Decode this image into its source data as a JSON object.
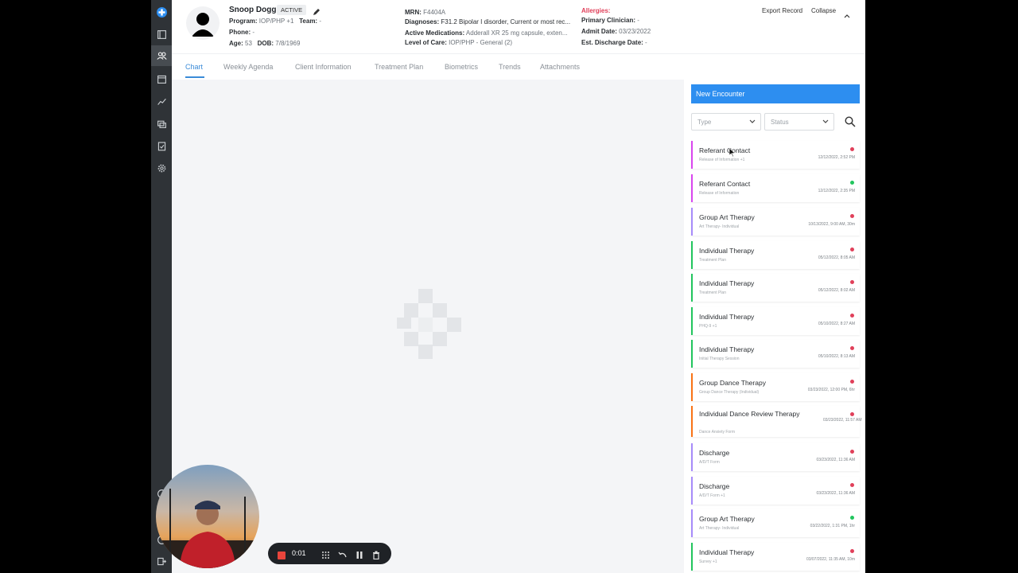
{
  "patient": {
    "name": "Snoop Dogg",
    "status": "ACTIVE",
    "program_label": "Program:",
    "program": "IOP/PHP +1",
    "team_label": "Team:",
    "team": "-",
    "phone_label": "Phone:",
    "phone": "-",
    "age_label": "Age:",
    "age": "53",
    "dob_label": "DOB:",
    "dob": "7/8/1969",
    "mrn_label": "MRN:",
    "mrn": "F4404A",
    "diagnoses_label": "Diagnoses:",
    "diagnoses": "F31.2 Bipolar I disorder, Current or most rec...",
    "medications_label": "Active Medications:",
    "medications": "Adderall XR 25 mg capsule, exten...",
    "loc_label": "Level of Care:",
    "loc": "IOP/PHP - General (2)",
    "allergies_label": "Allergies:",
    "clinician_label": "Primary Clinician:",
    "clinician": "-",
    "admit_label": "Admit Date:",
    "admit": "03/23/2022",
    "discharge_label": "Est. Discharge Date:",
    "discharge": "-"
  },
  "header_actions": {
    "export": "Export Record",
    "collapse": "Collapse"
  },
  "tabs": [
    {
      "label": "Chart"
    },
    {
      "label": "Weekly Agenda"
    },
    {
      "label": "Client Information"
    },
    {
      "label": "Treatment Plan"
    },
    {
      "label": "Biometrics"
    },
    {
      "label": "Trends"
    },
    {
      "label": "Attachments"
    }
  ],
  "encounters_panel": {
    "new_button": "New Encounter",
    "type_placeholder": "Type",
    "status_placeholder": "Status"
  },
  "encounters": [
    {
      "title": "Referant Contact",
      "sub": "Release of Information +1",
      "date": "12/12/2022, 2:52 PM",
      "color": "#d946ef",
      "dot": "#e0405a"
    },
    {
      "title": "Referant Contact",
      "sub": "Release of Information",
      "date": "12/12/2022, 2:35 PM",
      "color": "#d946ef",
      "dot": "#22c55e"
    },
    {
      "title": "Group Art Therapy",
      "sub": "Art Therapy- Individual",
      "date": "10/13/2022, 9:00 AM, 30m",
      "color": "#a78bfa",
      "dot": "#e0405a"
    },
    {
      "title": "Individual Therapy",
      "sub": "Treatment Plan",
      "date": "05/12/2022, 8:05 AM",
      "color": "#22c55e",
      "dot": "#e0405a"
    },
    {
      "title": "Individual Therapy",
      "sub": "Treatment Plan",
      "date": "05/12/2022, 8:02 AM",
      "color": "#22c55e",
      "dot": "#e0405a"
    },
    {
      "title": "Individual Therapy",
      "sub": "PHQ-9 +1",
      "date": "05/10/2022, 8:27 AM",
      "color": "#22c55e",
      "dot": "#e0405a"
    },
    {
      "title": "Individual Therapy",
      "sub": "Initial Therapy Session",
      "date": "05/10/2022, 8:13 AM",
      "color": "#22c55e",
      "dot": "#e0405a"
    },
    {
      "title": "Group Dance Therapy",
      "sub": "Group Dance Therapy (Individual)",
      "date": "03/23/2022, 12:00 PM, 6hr",
      "color": "#f97316",
      "dot": "#e0405a"
    },
    {
      "title": "Individual Dance Review Therapy",
      "sub": "Dance Anxiety Form",
      "date": "03/23/2022, 11:57 AM",
      "color": "#f97316",
      "dot": "#e0405a",
      "tall": true
    },
    {
      "title": "Discharge",
      "sub": "A/D/T Form",
      "date": "03/23/2022, 11:36 AM",
      "color": "#a78bfa",
      "dot": "#e0405a"
    },
    {
      "title": "Discharge",
      "sub": "A/D/T Form +1",
      "date": "03/23/2022, 11:36 AM",
      "color": "#a78bfa",
      "dot": "#e0405a"
    },
    {
      "title": "Group Art Therapy",
      "sub": "Art Therapy- Individual",
      "date": "03/22/2022, 1:31 PM, 1hr",
      "color": "#a78bfa",
      "dot": "#22c55e"
    },
    {
      "title": "Individual Therapy",
      "sub": "Survey +1",
      "date": "03/07/2022, 11:35 AM, 10m",
      "color": "#22c55e",
      "dot": "#e0405a"
    }
  ],
  "recorder": {
    "time": "0:01"
  },
  "colors": {
    "accent": "#2d8ef0",
    "sidebar": "#2f3337",
    "allergy_red": "#e0405a"
  }
}
